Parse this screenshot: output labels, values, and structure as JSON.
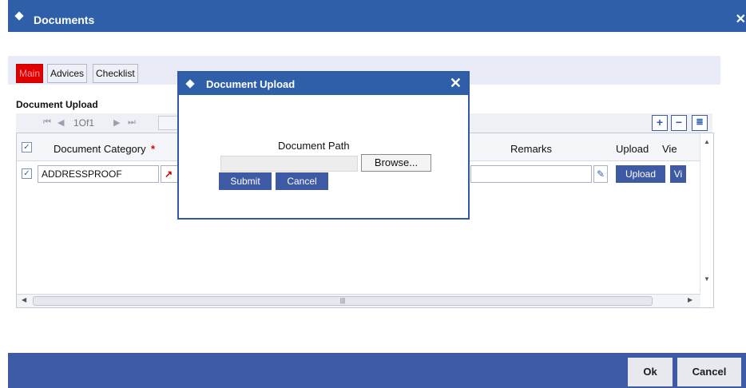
{
  "window": {
    "title": "Documents",
    "close_glyph": "✕"
  },
  "tabs": [
    {
      "label": "Main",
      "active": true
    },
    {
      "label": "Advices",
      "active": false
    },
    {
      "label": "Checklist",
      "active": false
    }
  ],
  "section": {
    "title": "Document Upload"
  },
  "pager": {
    "page_text": "1Of1",
    "first_icon": "first-page-icon",
    "prev_icon": "prev-page-icon",
    "next_icon": "next-page-icon",
    "last_icon": "last-page-icon"
  },
  "toolbar": {
    "add_glyph": "+",
    "remove_glyph": "−",
    "view_glyph": "≣"
  },
  "grid": {
    "headers": {
      "category": "Document Category",
      "required_mark": "*",
      "remarks": "Remarks",
      "upload": "Upload",
      "view": "Vie"
    },
    "rows": [
      {
        "checked": true,
        "category": "ADDRESSPROOF",
        "upload_label": "Upload",
        "view_label": "Vi"
      }
    ],
    "scroll_thumb_glyph": "|||"
  },
  "dialog": {
    "title": "Document Upload",
    "close_glyph": "✕",
    "path_label": "Document Path",
    "browse_label": "Browse...",
    "submit_label": "Submit",
    "cancel_label": "Cancel"
  },
  "footer": {
    "ok_label": "Ok",
    "cancel_label": "Cancel"
  },
  "colors": {
    "accent": "#2e5fa8",
    "footer": "#3f5aa4",
    "active_tab": "#e00000",
    "required": "#e00000"
  }
}
